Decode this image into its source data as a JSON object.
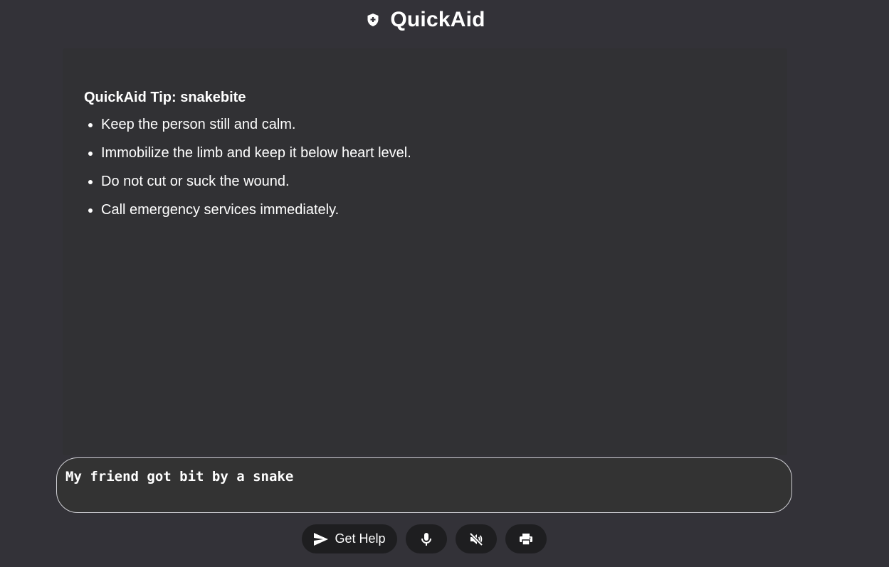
{
  "app": {
    "title": "QuickAid",
    "logo_icon": "shield-plus-icon"
  },
  "tip": {
    "title": "QuickAid Tip: snakebite",
    "items": [
      "Keep the person still and calm.",
      "Immobilize the limb and keep it below heart level.",
      "Do not cut or suck the wound.",
      "Call emergency services immediately."
    ]
  },
  "input": {
    "value": "My friend got bit by a snake"
  },
  "controls": {
    "get_help_label": "Get Help",
    "get_help_icon": "send-icon",
    "mic_icon": "microphone-icon",
    "mute_icon": "volume-off-icon",
    "print_icon": "printer-icon"
  },
  "colors": {
    "background": "#333238",
    "card": "#313134",
    "button": "#1e1e20",
    "input_border": "#cfcfd4",
    "text": "#ffffff"
  }
}
